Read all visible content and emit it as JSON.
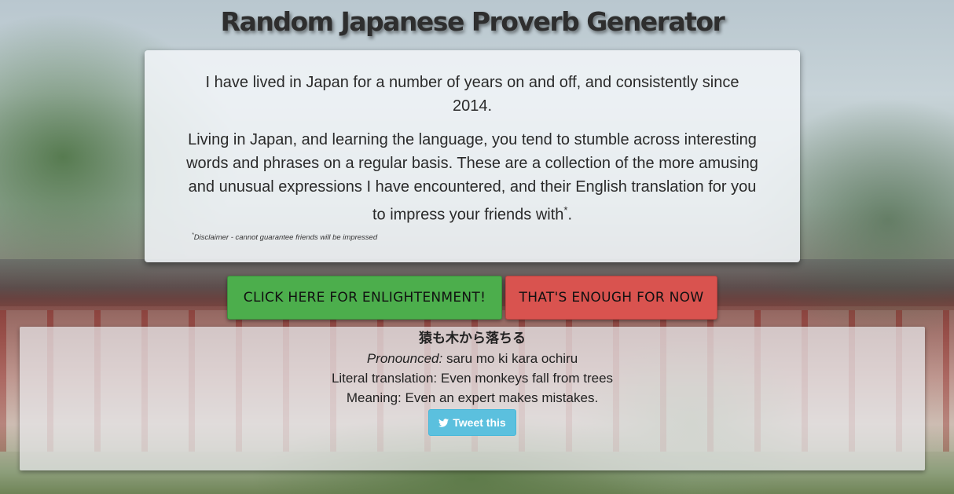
{
  "header": {
    "title": "Random Japanese Proverb Generator"
  },
  "intro": {
    "paragraph1": "I have lived in Japan for a number of years on and off, and consistently since 2014.",
    "paragraph2": "Living in Japan, and learning the language, you tend to stumble across interesting words and phrases on a regular basis. These are a collection of the more amusing and unusual expressions I have encountered, and their English translation for you to impress your friends with",
    "paragraph2_asterisk": "*",
    "paragraph2_end": ".",
    "disclaimer_asterisk": "*",
    "disclaimer": "Disclaimer - cannot guarantee friends will be impressed"
  },
  "buttons": {
    "enlighten_label": "CLICK HERE FOR ENLIGHTENMENT!",
    "enough_label": "THAT'S ENOUGH FOR NOW"
  },
  "proverb": {
    "japanese": "猿も木から落ちる",
    "pronounced_label": "Pronounced:",
    "pronounced": "saru mo ki kara ochiru",
    "literal_label": "Literal translation:",
    "literal": "Even monkeys fall from trees",
    "meaning_label": "Meaning:",
    "meaning": "Even an expert makes mistakes.",
    "tweet_label": "Tweet this",
    "tweet_icon": "twitter-bird-icon"
  },
  "colors": {
    "enlighten_button": "#4cae4c",
    "enough_button": "#d9534f",
    "tweet_button": "#5bc0de"
  }
}
